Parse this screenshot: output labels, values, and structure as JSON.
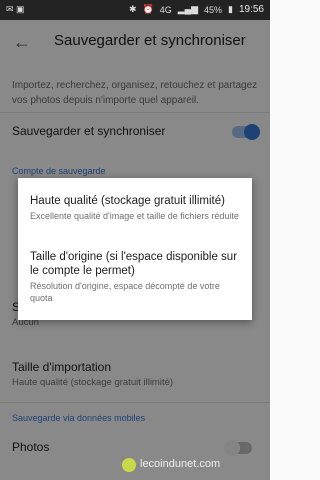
{
  "status": {
    "network": "4G",
    "battery": "45%",
    "time": "19:56"
  },
  "appbar": {
    "title": "Sauvegarder et synchroniser"
  },
  "description": "Importez, recherchez, organisez, retouchez et partagez vos photos depuis n'importe quel appareil.",
  "backup_toggle": {
    "label": "Sauvegarder et synchroniser",
    "on": true
  },
  "account_section": {
    "label": "Compte de sauvegarde"
  },
  "storage_row": {
    "label_partial": "S",
    "value": "Aucun"
  },
  "upload_size": {
    "label": "Taille d'importation",
    "value": "Haute qualité (stockage gratuit illimité)"
  },
  "mobile_section": {
    "label": "Sauvegarde via données mobiles"
  },
  "photos_toggle": {
    "label": "Photos",
    "on": false
  },
  "dialog": {
    "options": [
      {
        "title": "Haute qualité (stockage gratuit illimité)",
        "subtitle": "Excellente qualité d'image et taille de fichiers réduite"
      },
      {
        "title": "Taille d'origine (si l'espace disponible sur le compte le permet)",
        "subtitle": "Résolution d'origine, espace décompté de votre quota"
      }
    ]
  },
  "watermark": "lecoindunet.com",
  "colors": {
    "accent": "#3a78d8",
    "toggle_on": "#3a78d8",
    "status_bg": "#232323"
  }
}
